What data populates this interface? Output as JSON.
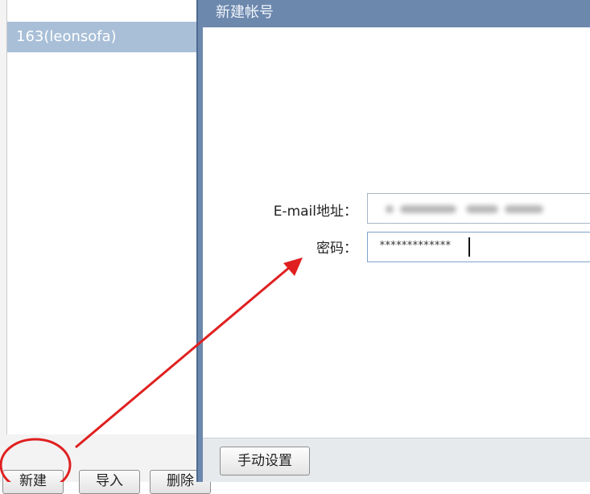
{
  "account_list": {
    "items": [
      {
        "label": "163(leonsofa)"
      }
    ]
  },
  "left_buttons": {
    "new_label": "新建",
    "import_label": "导入",
    "delete_label": "删除"
  },
  "dialog": {
    "title": "新建帐号",
    "email_label": "E-mail地址：",
    "email_value_obscured": true,
    "password_label": "密码：",
    "password_value": "*************",
    "manual_settings_label": "手动设置"
  },
  "annotation": {
    "color": "#e02020",
    "circle_target": "new-button",
    "arrow_target": "password-field"
  }
}
